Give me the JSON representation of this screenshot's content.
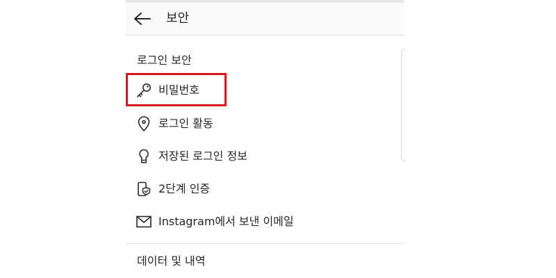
{
  "header": {
    "title": "보안",
    "back_icon": "arrow-left-icon"
  },
  "sections": {
    "login_security": {
      "title": "로그인 보안",
      "items": [
        {
          "label": "비밀번호",
          "icon": "key-icon"
        },
        {
          "label": "로그인 활동",
          "icon": "location-pin-icon"
        },
        {
          "label": "저장된 로그인 정보",
          "icon": "keyhole-icon"
        },
        {
          "label": "2단계 인증",
          "icon": "phone-shield-icon"
        },
        {
          "label": "Instagram에서 보낸 이메일",
          "icon": "mail-icon"
        }
      ]
    },
    "data_history": {
      "title": "데이터 및 내역"
    }
  },
  "colors": {
    "highlight": "#d9141b",
    "text": "#262626",
    "header_bg": "#fafafa",
    "divider": "#dbdbdb"
  }
}
